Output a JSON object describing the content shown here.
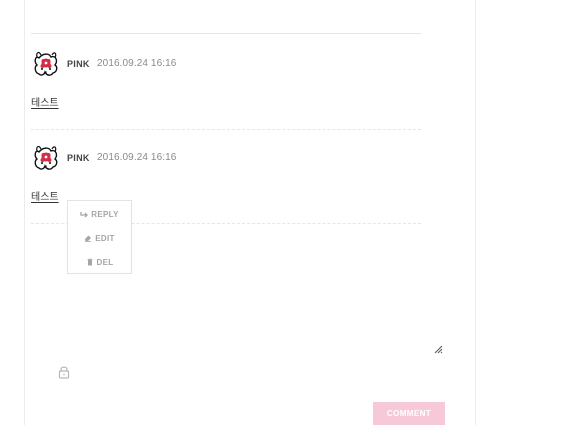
{
  "comments": [
    {
      "author": "PINK",
      "date": "2016.09.24 16:16",
      "text": "테스트",
      "avatar_icon": "bunny-avatar-icon"
    },
    {
      "author": "PINK",
      "date": "2016.09.24 16:16",
      "text": "테스트",
      "avatar_icon": "bunny-avatar-icon"
    }
  ],
  "context_menu": {
    "items": [
      {
        "label": "REPLY",
        "icon": "reply-arrow-icon"
      },
      {
        "label": "EDIT",
        "icon": "eraser-icon"
      },
      {
        "label": "DEL",
        "icon": "trash-icon"
      }
    ]
  },
  "comment_form": {
    "textarea_value": "",
    "lock_icon": "lock-icon",
    "resize_icon": "resize-grip-icon",
    "submit_label": "COMMENT"
  },
  "colors": {
    "accent_button": "#f7c9d8",
    "avatar_flower": "#d62d47",
    "text_dark": "#333333",
    "text_muted": "#8a8a8a",
    "menu_text": "#a5a5a5"
  }
}
